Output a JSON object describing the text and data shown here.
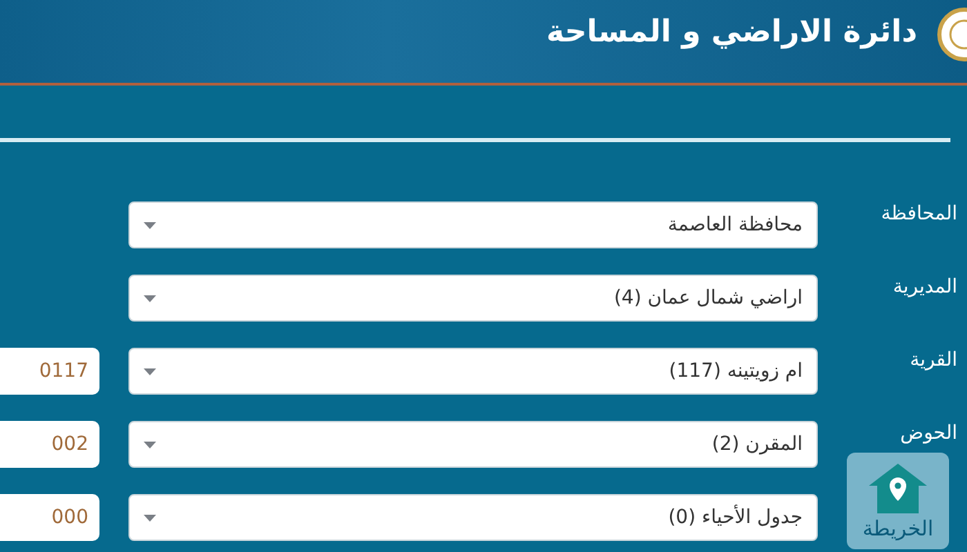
{
  "header": {
    "title": "دائرة الاراضي و المساحة"
  },
  "fields": [
    {
      "label": "المحافظة",
      "value": "محافظة العاصمة"
    },
    {
      "label": "المديرية",
      "value": "اراضي شمال عمان (4)"
    },
    {
      "label": "القرية",
      "value": "ام زويتينه (117)",
      "code": "0117"
    },
    {
      "label": "الحوض",
      "value": "المقرن (2)",
      "code": "002"
    },
    {
      "value": "جدول الأحياء (0)",
      "code": "000"
    }
  ],
  "map_button": {
    "label": "الخريطة"
  }
}
